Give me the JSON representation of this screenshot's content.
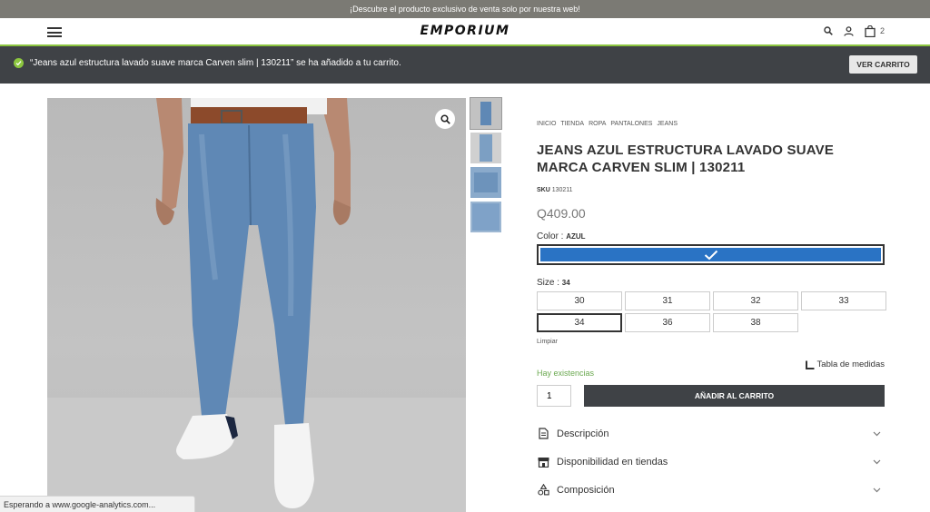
{
  "announcement": "¡Descubre el producto exclusivo de venta solo por nuestra web!",
  "header": {
    "logo": "EMPORIUM",
    "cart_count": "2",
    "icons": [
      "menu-icon",
      "search-icon",
      "user-icon",
      "bag-icon"
    ]
  },
  "notice": {
    "message": "“Jeans azul estructura lavado suave marca Carven slim | 130211” se ha añadido a tu carrito.",
    "button": "VER CARRITO"
  },
  "product": {
    "breadcrumb": [
      "INICIO",
      "TIENDA",
      "ROPA",
      "PANTALONES",
      "JEANS"
    ],
    "title": "JEANS AZUL ESTRUCTURA LAVADO SUAVE MARCA CARVEN SLIM | 130211",
    "sku_label": "SKU",
    "sku": "130211",
    "price": "Q409.00",
    "color_label": "Color :",
    "color_value": "AZUL",
    "swatch_color": "#2a73c4",
    "size_label": "Size :",
    "size_value": "34",
    "sizes": [
      "30",
      "31",
      "32",
      "33",
      "34",
      "36",
      "38"
    ],
    "selected_size": "34",
    "clear": "Limpiar",
    "stock": "Hay existencias",
    "size_table": "Tabla de medidas",
    "qty": "1",
    "add_to_cart": "AÑADIR AL CARRITO",
    "accordion": [
      {
        "label": "Descripción",
        "icon": "document-icon"
      },
      {
        "label": "Disponibilidad en tiendas",
        "icon": "store-icon"
      },
      {
        "label": "Composición",
        "icon": "shapes-icon"
      }
    ]
  },
  "status_bar": "Esperando a www.google-analytics.com...",
  "colors": {
    "accent_green": "#8cc63f",
    "dark": "#3f4246",
    "stock_green": "#6aa84f"
  }
}
